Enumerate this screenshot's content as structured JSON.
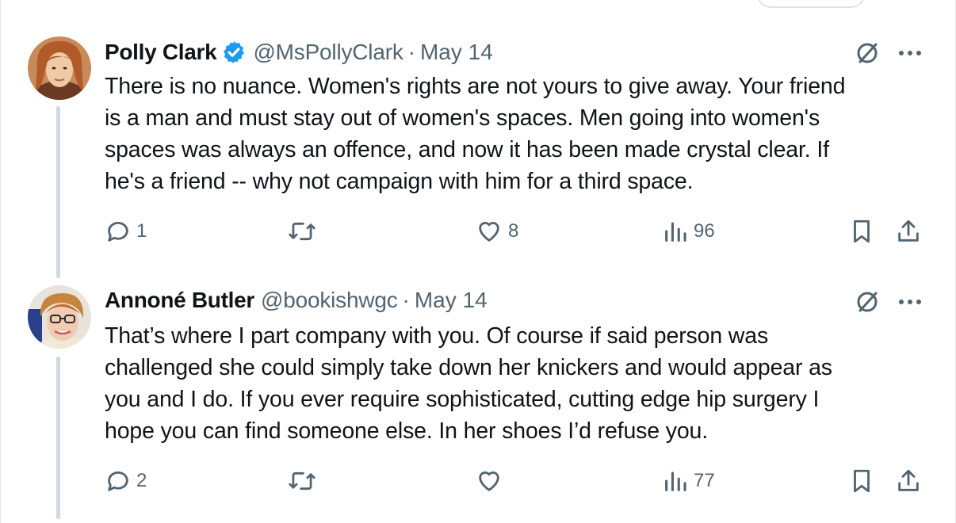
{
  "header_pill": {},
  "tweets": [
    {
      "name": "Polly Clark",
      "verified": true,
      "handle": "@MsPollyClark",
      "separator": "·",
      "date": "May 14",
      "text": "There is no nuance. Women's rights are not yours to give away. Your friend is a man and must stay out of women's spaces. Men going into women's spaces was always an offence, and now it has been made crystal clear. If he's a friend -- why not campaign with him for a third space.",
      "lines": [
        "There is no nuance. Women's rights are not yours to give away. Your friend",
        "is a man and must stay out of women's spaces. Men going into women's",
        "spaces was always an offence, and now it has been made crystal clear. If",
        "he's a friend -- why not campaign with him for a third space."
      ],
      "replies": "1",
      "reposts": "",
      "likes": "8",
      "views": "96",
      "icons": [
        "grok-icon",
        "more-icon",
        "reply-icon",
        "repost-icon",
        "like-icon",
        "views-icon",
        "bookmark-icon",
        "share-icon"
      ]
    },
    {
      "name": "Annoné Butler",
      "verified": false,
      "handle": "@bookishwgc",
      "separator": "·",
      "date": "May 14",
      "text": "That’s where I part company with you. Of course if said person was challenged she could simply take down her knickers and would appear as you and I do. If you ever require sophisticated, cutting edge hip surgery I hope you can find someone else. In her shoes I’d refuse you.",
      "lines": [
        "That’s where I part company with you. Of course if said person was",
        "challenged she could simply take down her knickers and would appear as",
        "you and I do. If you ever require sophisticated, cutting edge hip surgery I",
        "hope you can find someone else. In her shoes I’d refuse you."
      ],
      "replies": "2",
      "reposts": "",
      "likes": "",
      "views": "77",
      "icons": [
        "grok-icon",
        "more-icon",
        "reply-icon",
        "repost-icon",
        "like-icon",
        "views-icon",
        "bookmark-icon",
        "share-icon"
      ]
    }
  ],
  "colors": {
    "text": "#0f1419",
    "secondary": "#536471",
    "verified": "#1d9bf0",
    "thread_line": "#cfd9de"
  }
}
